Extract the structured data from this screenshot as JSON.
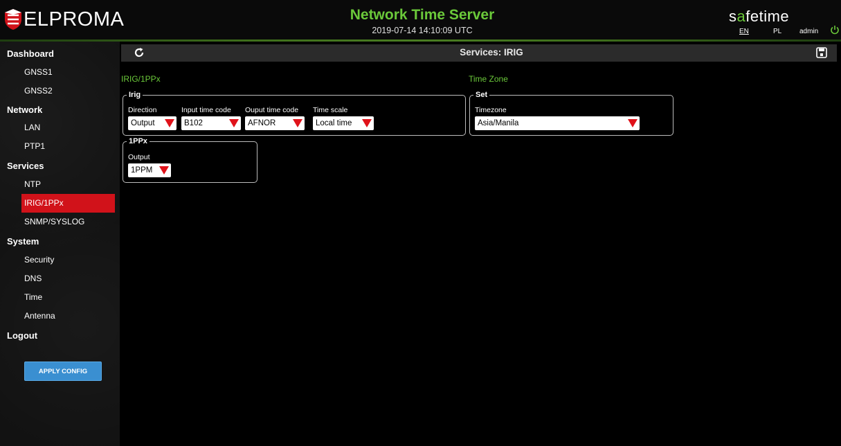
{
  "header": {
    "logo_text": "ELPROMA",
    "title": "Network Time Server",
    "datetime": "2019-07-14 14:10:09 UTC",
    "brand_pre": "s",
    "brand_accent": "a",
    "brand_post": "fetime",
    "lang_en": "EN",
    "lang_pl": "PL",
    "user": "admin",
    "accent_color": "#6bc93a"
  },
  "sidebar": {
    "sections": [
      {
        "label": "Dashboard",
        "items": [
          "GNSS1",
          "GNSS2"
        ]
      },
      {
        "label": "Network",
        "items": [
          "LAN",
          "PTP1"
        ]
      },
      {
        "label": "Services",
        "items": [
          "NTP",
          "IRIG/1PPx",
          "SNMP/SYSLOG"
        ]
      },
      {
        "label": "System",
        "items": [
          "Security",
          "DNS",
          "Time",
          "Antenna"
        ]
      },
      {
        "label": "Logout",
        "items": []
      }
    ],
    "active_item": "IRIG/1PPx",
    "active_color": "#d1121a",
    "apply_label": "APPLY CONFIG"
  },
  "main": {
    "title": "Services: IRIG",
    "left_section": "IRIG/1PPx",
    "right_section": "Time Zone",
    "irig": {
      "legend": "Irig",
      "direction_label": "Direction",
      "direction_value": "Output",
      "input_code_label": "Input time code",
      "input_code_value": "B102",
      "output_code_label": "Ouput time code",
      "output_code_value": "AFNOR",
      "scale_label": "Time scale",
      "scale_value": "Local time"
    },
    "ppx": {
      "legend": "1PPx",
      "output_label": "Output",
      "output_value": "1PPM"
    },
    "set": {
      "legend": "Set",
      "timezone_label": "Timezone",
      "timezone_value": "Asia/Manila"
    }
  }
}
